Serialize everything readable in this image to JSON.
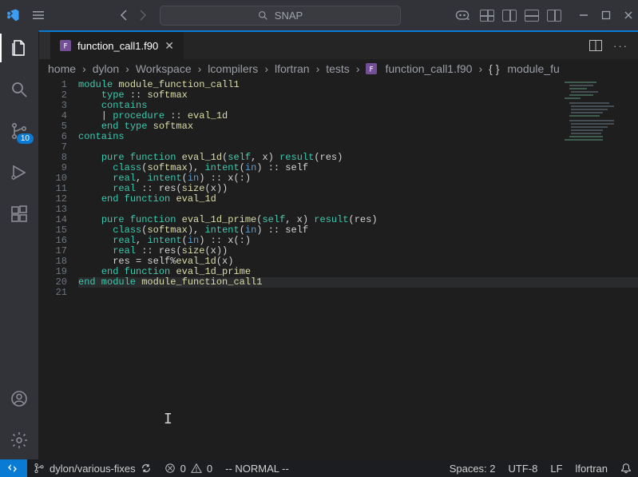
{
  "titlebar": {
    "search_placeholder": "SNAP"
  },
  "activity": {
    "scm_badge": "10"
  },
  "tab": {
    "filename": "function_call1.f90"
  },
  "breadcrumbs": {
    "parts": [
      "home",
      "dylon",
      "Workspace",
      "lcompilers",
      "lfortran",
      "tests"
    ],
    "file": "function_call1.f90",
    "symbol": "module_fu"
  },
  "code": {
    "lines": [
      [
        [
          "kw0",
          "module "
        ],
        [
          "ident",
          "module_function_call1"
        ]
      ],
      [
        [
          "sym",
          "    "
        ],
        [
          "kw0",
          "type"
        ],
        [
          "sym",
          " :: "
        ],
        [
          "ident",
          "softmax"
        ]
      ],
      [
        [
          "sym",
          "    "
        ],
        [
          "kw0",
          "contains"
        ]
      ],
      [
        [
          "sym",
          "    | "
        ],
        [
          "kw0",
          "procedure"
        ],
        [
          "sym",
          " :: "
        ],
        [
          "ident",
          "eval_1d"
        ]
      ],
      [
        [
          "sym",
          "    "
        ],
        [
          "kw0",
          "end type "
        ],
        [
          "ident",
          "softmax"
        ]
      ],
      [
        [
          "kw0",
          "contains"
        ]
      ],
      [
        [
          "sym",
          ""
        ]
      ],
      [
        [
          "sym",
          "    "
        ],
        [
          "kw0",
          "pure function "
        ],
        [
          "ident",
          "eval_1d"
        ],
        [
          "sym",
          "("
        ],
        [
          "kw1",
          "self"
        ],
        [
          "sym",
          ", x) "
        ],
        [
          "kw0",
          "result"
        ],
        [
          "sym",
          "(res)"
        ]
      ],
      [
        [
          "sym",
          "      "
        ],
        [
          "kw0",
          "class"
        ],
        [
          "sym",
          "("
        ],
        [
          "ident",
          "softmax"
        ],
        [
          "sym",
          "), "
        ],
        [
          "kw0",
          "intent"
        ],
        [
          "sym",
          "("
        ],
        [
          "attr",
          "in"
        ],
        [
          "sym",
          ") :: self"
        ]
      ],
      [
        [
          "sym",
          "      "
        ],
        [
          "kw0",
          "real"
        ],
        [
          "sym",
          ", "
        ],
        [
          "kw0",
          "intent"
        ],
        [
          "sym",
          "("
        ],
        [
          "attr",
          "in"
        ],
        [
          "sym",
          ") :: x(:)"
        ]
      ],
      [
        [
          "sym",
          "      "
        ],
        [
          "kw0",
          "real"
        ],
        [
          "sym",
          " :: res("
        ],
        [
          "ident",
          "size"
        ],
        [
          "sym",
          "(x))"
        ]
      ],
      [
        [
          "sym",
          "    "
        ],
        [
          "kw0",
          "end function "
        ],
        [
          "ident",
          "eval_1d"
        ]
      ],
      [
        [
          "sym",
          ""
        ]
      ],
      [
        [
          "sym",
          "    "
        ],
        [
          "kw0",
          "pure function "
        ],
        [
          "ident",
          "eval_1d_prime"
        ],
        [
          "sym",
          "("
        ],
        [
          "kw1",
          "self"
        ],
        [
          "sym",
          ", x) "
        ],
        [
          "kw0",
          "result"
        ],
        [
          "sym",
          "(res)"
        ]
      ],
      [
        [
          "sym",
          "      "
        ],
        [
          "kw0",
          "class"
        ],
        [
          "sym",
          "("
        ],
        [
          "ident",
          "softmax"
        ],
        [
          "sym",
          "), "
        ],
        [
          "kw0",
          "intent"
        ],
        [
          "sym",
          "("
        ],
        [
          "attr",
          "in"
        ],
        [
          "sym",
          ") :: self"
        ]
      ],
      [
        [
          "sym",
          "      "
        ],
        [
          "kw0",
          "real"
        ],
        [
          "sym",
          ", "
        ],
        [
          "kw0",
          "intent"
        ],
        [
          "sym",
          "("
        ],
        [
          "attr",
          "in"
        ],
        [
          "sym",
          ") :: x(:)"
        ]
      ],
      [
        [
          "sym",
          "      "
        ],
        [
          "kw0",
          "real"
        ],
        [
          "sym",
          " :: res("
        ],
        [
          "ident",
          "size"
        ],
        [
          "sym",
          "(x))"
        ]
      ],
      [
        [
          "sym",
          "      res = self%"
        ],
        [
          "ident",
          "eval_1d"
        ],
        [
          "sym",
          "(x)"
        ]
      ],
      [
        [
          "sym",
          "    "
        ],
        [
          "kw0",
          "end function "
        ],
        [
          "ident",
          "eval_1d_prime"
        ]
      ],
      [
        [
          "kw0",
          "end module "
        ],
        [
          "ident",
          "module_function_call1"
        ]
      ],
      [
        [
          "sym",
          ""
        ]
      ]
    ]
  },
  "status": {
    "branch": "dylon/various-fixes",
    "errors": "0",
    "warnings": "0",
    "vim_mode": "-- NORMAL --",
    "indent": "Spaces: 2",
    "encoding": "UTF-8",
    "eol": "LF",
    "language": "lfortran"
  }
}
